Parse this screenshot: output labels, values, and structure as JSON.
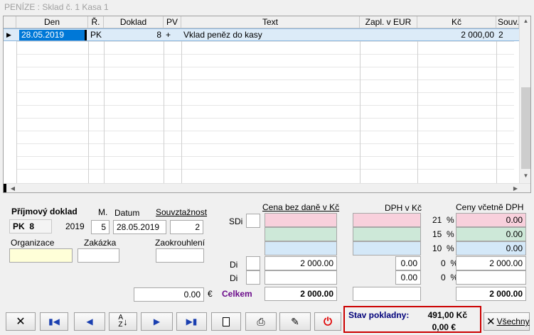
{
  "window": {
    "title": "PENÍZE : Sklad č. 1 Kasa 1"
  },
  "grid": {
    "columns": [
      "Den",
      "Ř.",
      "Doklad",
      "PV",
      "Text",
      "Zapl. v EUR",
      "Kč",
      "Souv."
    ],
    "rows": [
      {
        "den": "28.05.2019",
        "rada": "PK",
        "doklad": "8",
        "pv": "+",
        "text": "Vklad peněz do kasy",
        "eur": "",
        "kc": "2 000,00",
        "souv": "2"
      }
    ]
  },
  "doc": {
    "title": "Příjmový doklad",
    "type": "PK",
    "number": "8",
    "year": "2019",
    "month_label": "M.",
    "month": "5",
    "date_label": "Datum",
    "date": "28.05.2019",
    "souv_label": "Souvztažnost",
    "souv": "2",
    "org_label": "Organizace",
    "org": "",
    "zak_label": "Zakázka",
    "zak": "",
    "zaokr_label": "Zaokrouhlení",
    "zaokr": "",
    "eur_value": "0.00",
    "eur_symbol": "€"
  },
  "vat": {
    "col_cena": "Cena bez daně v Kč",
    "col_dph": "DPH v Kč",
    "col_ceny": "Ceny včetně DPH",
    "sdi_label": "SDi",
    "di1_label": "Di",
    "di2_label": "Di",
    "rate21": "21",
    "rate15": "15",
    "rate10": "10",
    "rate0a": "0",
    "rate0b": "0",
    "pct": "%",
    "incl21": "0.00",
    "incl15": "0.00",
    "incl10": "0.00",
    "di1_cena": "2 000.00",
    "di1_dph": "0.00",
    "di1_incl": "2 000.00",
    "di2_dph": "0.00",
    "celkem_label": "Celkem",
    "celkem_cena": "2 000.00",
    "celkem_incl": "2 000.00"
  },
  "status": {
    "label": "Stav pokladny:",
    "kc": "491,00 Kč",
    "eur": "0,00 €"
  },
  "toolbar": {
    "all_label": "Všechny"
  },
  "colors": {
    "pink": "#f8d0dc",
    "green": "#cde8d8",
    "blue": "#d4e8f8",
    "yellow": "#ffffd8",
    "selection": "#0078d7",
    "status_border": "#cc0000",
    "celkem": "#6a0a8a",
    "status_text": "#00007a"
  }
}
